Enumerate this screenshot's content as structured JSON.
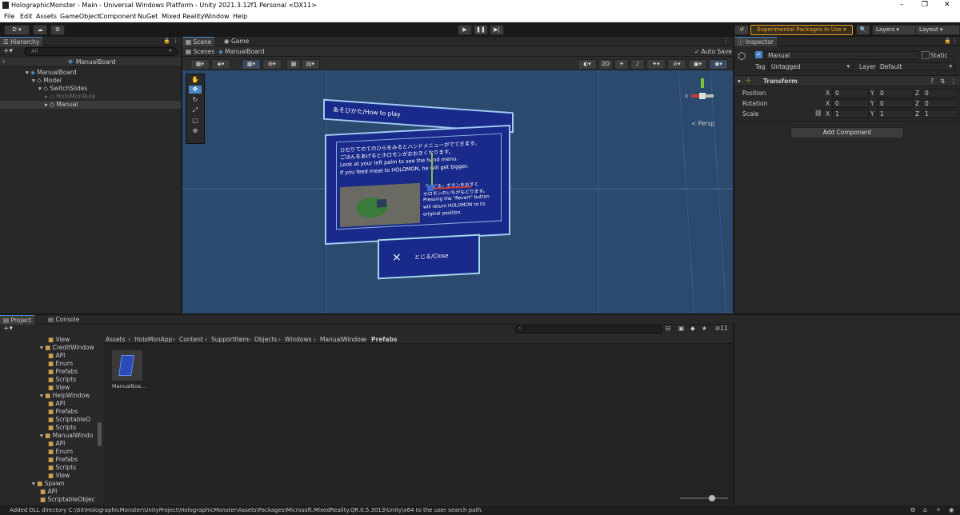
{
  "window": {
    "title": "HolographicMonster - Main - Universal Windows Platform - Unity 2021.3.12f1 Personal <DX11>"
  },
  "menu": [
    "File",
    "Edit",
    "Assets",
    "GameObject",
    "Component",
    "NuGet",
    "Mixed Reality",
    "Window",
    "Help"
  ],
  "toolbar": {
    "account": "D",
    "experimental": "Experimental Packages In Use",
    "layers": "Layers",
    "layout": "Layout"
  },
  "hierarchy": {
    "tab": "Hierarchy",
    "search_placeholder": "All",
    "scene_root": "ManualBoard",
    "items": [
      {
        "label": "ManualBoard",
        "depth": 0
      },
      {
        "label": "Model",
        "depth": 1
      },
      {
        "label": "SwitchSlides",
        "depth": 2
      },
      {
        "label": "HoloMonRule",
        "depth": 3
      },
      {
        "label": "Manual",
        "depth": 3
      }
    ]
  },
  "scene": {
    "tab_scene": "Scene",
    "tab_game": "Game",
    "breadcrumb_scenes": "Scenes",
    "breadcrumb_prefab": "ManualBoard",
    "auto_save": "Auto Save",
    "mode_2d": "2D",
    "persp": "< Persp",
    "gizmo_x": "x",
    "board": {
      "header": "あそびかた/How to play",
      "text_jp1": "ひだりてのてのひらをみるとハンドメニューがでてきます。",
      "text_jp2": "ごはんをあげるとホロモンがおおきくなります。",
      "text_en1": "Look at your left palm to see the hand menu.",
      "text_en2": "If you feed meat to HOLOMON, he will get bigger.",
      "side_jp1": "「もどる」ボタンをおすと",
      "side_jp2": "ホロモンのいちがもどります。",
      "side_en1": "Pressing the \"Revert\" button",
      "side_en2": "will return HOLOMON to its",
      "side_en3": "original position.",
      "close_label": "とじる/Close",
      "close_icon": "×"
    }
  },
  "inspector": {
    "tab": "Inspector",
    "object_name": "Manual",
    "static_label": "Static",
    "tag_label": "Tag",
    "tag_value": "Untagged",
    "layer_label": "Layer",
    "layer_value": "Default",
    "transform_label": "Transform",
    "position_label": "Position",
    "rotation_label": "Rotation",
    "scale_label": "Scale",
    "axis_x": "X",
    "axis_y": "Y",
    "axis_z": "Z",
    "position": [
      "0",
      "0",
      "0"
    ],
    "rotation": [
      "0",
      "0",
      "0"
    ],
    "scale": [
      "1",
      "1",
      "1"
    ],
    "add_component": "Add Component"
  },
  "project": {
    "tab_project": "Project",
    "tab_console": "Console",
    "hidden_count": "11",
    "breadcrumb": [
      "Assets",
      "HoloMonApp",
      "Content",
      "SupportItem",
      "Objects",
      "Windows",
      "ManualWindow",
      "Prefabs"
    ],
    "tree": [
      {
        "label": "View",
        "depth": 3
      },
      {
        "label": "CreditWindow",
        "depth": 2
      },
      {
        "label": "API",
        "depth": 3
      },
      {
        "label": "Enum",
        "depth": 3
      },
      {
        "label": "Prefabs",
        "depth": 3
      },
      {
        "label": "Scripts",
        "depth": 3
      },
      {
        "label": "View",
        "depth": 3
      },
      {
        "label": "HelpWindow",
        "depth": 2
      },
      {
        "label": "API",
        "depth": 3
      },
      {
        "label": "Prefabs",
        "depth": 3
      },
      {
        "label": "ScriptableO",
        "depth": 3
      },
      {
        "label": "Scripts",
        "depth": 3
      },
      {
        "label": "ManualWindo",
        "depth": 2
      },
      {
        "label": "API",
        "depth": 3
      },
      {
        "label": "Enum",
        "depth": 3
      },
      {
        "label": "Prefabs",
        "depth": 3
      },
      {
        "label": "Scripts",
        "depth": 3
      },
      {
        "label": "View",
        "depth": 3
      },
      {
        "label": "Spawn",
        "depth": 1
      },
      {
        "label": "API",
        "depth": 2
      },
      {
        "label": "ScriptableObjec",
        "depth": 2
      }
    ],
    "asset": {
      "label": "ManualBoa..."
    }
  },
  "status": {
    "text": "Added DLL directory C:\\Git\\HolographicMonster\\UnityProject\\HolographicMonster\\Assets\\Packages\\Microsoft.MixedReality.QR.0.5.3013\\Unity\\x64 to the user search path."
  },
  "colors": {
    "scene_bg": "#2c4a6e",
    "board_bg": "#1a2a8a",
    "accent": "#4a86c8",
    "experimental": "#f0a030"
  }
}
